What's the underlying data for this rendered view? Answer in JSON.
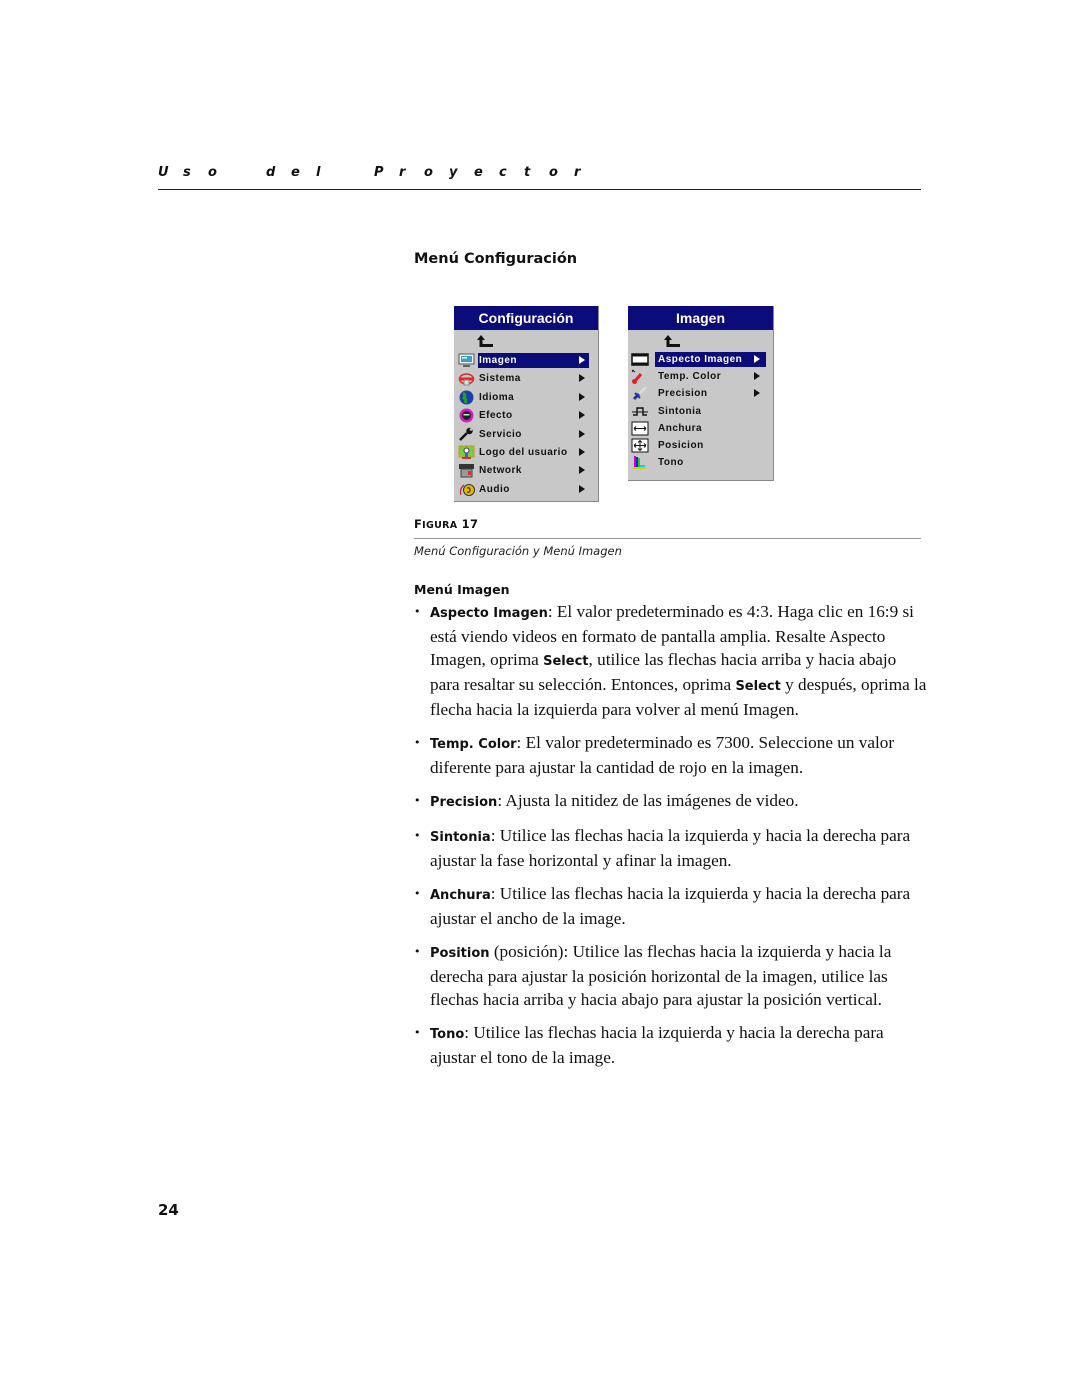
{
  "header": {
    "running_head_words": [
      "Uso",
      "del",
      "Proyector"
    ]
  },
  "section_title": "Menú Configuración",
  "menus": {
    "configuracion": {
      "title": "Configuración",
      "back_icon": "back-arrow-icon",
      "items": [
        {
          "label": "Imagen",
          "icon": "monitor-icon",
          "has_submenu": true,
          "selected": true
        },
        {
          "label": "Sistema",
          "icon": "system-icon",
          "has_submenu": true,
          "selected": false
        },
        {
          "label": "Idioma",
          "icon": "globe-icon",
          "has_submenu": true,
          "selected": false
        },
        {
          "label": "Efecto",
          "icon": "effect-icon",
          "has_submenu": true,
          "selected": false
        },
        {
          "label": "Servicio",
          "icon": "wrench-icon",
          "has_submenu": true,
          "selected": false
        },
        {
          "label": "Logo del usuario",
          "icon": "user-logo-icon",
          "has_submenu": true,
          "selected": false
        },
        {
          "label": "Network",
          "icon": "network-icon",
          "has_submenu": true,
          "selected": false
        },
        {
          "label": "Audio",
          "icon": "audio-icon",
          "has_submenu": true,
          "selected": false
        }
      ]
    },
    "imagen": {
      "title": "Imagen",
      "back_icon": "back-arrow-icon",
      "items": [
        {
          "label": "Aspecto Imagen",
          "icon": "aspect-ratio-icon",
          "has_submenu": true,
          "selected": true
        },
        {
          "label": "Temp. Color",
          "icon": "thermometer-icon",
          "has_submenu": true,
          "selected": false
        },
        {
          "label": "Precision",
          "icon": "sharpness-icon",
          "has_submenu": true,
          "selected": false
        },
        {
          "label": "Sintonia",
          "icon": "tracking-icon",
          "has_submenu": false,
          "selected": false
        },
        {
          "label": "Anchura",
          "icon": "width-icon",
          "has_submenu": false,
          "selected": false
        },
        {
          "label": "Posicion",
          "icon": "position-icon",
          "has_submenu": false,
          "selected": false
        },
        {
          "label": "Tono",
          "icon": "tint-icon",
          "has_submenu": false,
          "selected": false
        }
      ]
    },
    "colors": {
      "title_bar": "#0b0b7a",
      "menu_bg": "#c8c8c8",
      "highlight_text": "#ffffff"
    }
  },
  "figure": {
    "label": "Figura 17",
    "caption": "Menú Configuración y Menú Imagen"
  },
  "subsection_title": "Menú Imagen",
  "bullets": [
    {
      "term": "Aspecto Imagen",
      "parts": [
        {
          "t": ": El valor predeterminado es 4:3. Haga clic en 16:9 si está viendo videos en formato de pantalla amplia. Resalte Aspecto Imagen, oprima "
        },
        {
          "k": "Select"
        },
        {
          "t": ", utilice las flechas hacia arriba y hacia abajo para resaltar su selección. Entonces, oprima "
        },
        {
          "k": "Select"
        },
        {
          "t": " y después, oprima la flecha hacia la izquierda para volver al menú Imagen."
        }
      ]
    },
    {
      "term": "Temp. Color",
      "parts": [
        {
          "t": ": El valor predeterminado es 7300. Seleccione un valor diferente para ajustar la cantidad de rojo en la imagen."
        }
      ]
    },
    {
      "term": "Precision",
      "parts": [
        {
          "t": ": Ajusta la nitidez de las imágenes de video."
        }
      ]
    },
    {
      "term": "Sintonia",
      "parts": [
        {
          "t": ": Utilice las flechas hacia la izquierda y hacia la derecha para ajustar la fase horizontal y afinar la imagen."
        }
      ]
    },
    {
      "term": "Anchura",
      "parts": [
        {
          "t": ": Utilice las flechas hacia la izquierda y hacia la derecha para ajustar el ancho de la image."
        }
      ]
    },
    {
      "term": "Position",
      "parts": [
        {
          "t": " (posición): Utilice las flechas hacia la izquierda y hacia la derecha para ajustar la posición horizontal de la imagen, utilice las flechas hacia arriba y hacia abajo para ajustar la posición vertical."
        }
      ]
    },
    {
      "term": "Tono",
      "parts": [
        {
          "t": ": Utilice las flechas hacia la izquierda y hacia la derecha para ajustar el tono de la image."
        }
      ]
    }
  ],
  "page_number": "24"
}
